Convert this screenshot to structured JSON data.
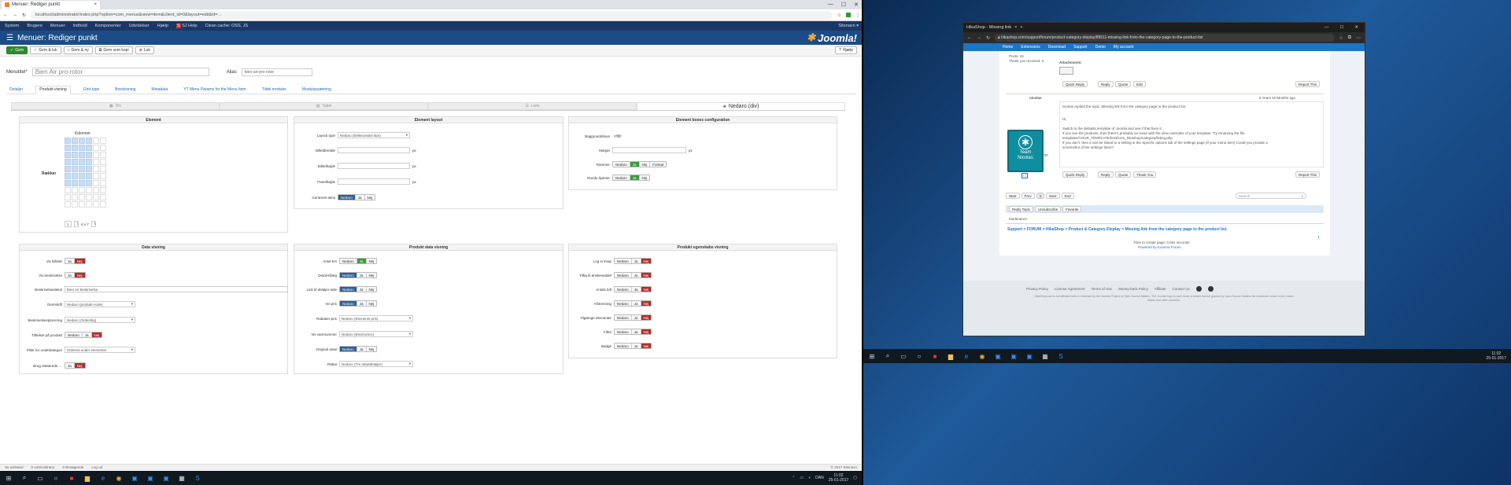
{
  "left": {
    "tab_title": "Menuer: Rediger punkt",
    "url": "localhost/administrator/index.php?option=com_menus&view=item&client_id=0&layout=edit&id=…",
    "admin_menu": [
      "System",
      "Brugere",
      "Menuer",
      "Indhold",
      "Komponenter",
      "Udvidelser",
      "Hjælp",
      "SJ Help",
      "Clean cache: OSS, JS"
    ],
    "admin_user": "Sitenavn ▾",
    "page_title": "Menuer: Rediger punkt",
    "logo_text": "Joomla!",
    "toolbar": {
      "save": "Gem",
      "save_close": "Gem & luk",
      "save_new": "Gem & ny",
      "save_copy": "Gem som kopi",
      "close": "Luk",
      "help": "Hjælp"
    },
    "menu_title_label": "Menutitel*",
    "menu_title_value": "Bien Air pro-rotor",
    "alias_label": "Alias",
    "alias_value": "bien-air-pro-rotor",
    "tabs": [
      "Detaljer",
      "Produkt-visning",
      "Grid-type",
      "Bredvisning",
      "Metadata",
      "YT Menu Params for the Menu Item",
      "Tildel moduler",
      "Modulopsætning"
    ],
    "layout_buttons": [
      "Div",
      "Tabel",
      "Liste",
      "Nedaro (div)"
    ],
    "element": {
      "title": "Element",
      "columns_label": "Kolonner",
      "rows_label": "Rækker",
      "size_value": "4 x 7"
    },
    "layout_panel": {
      "title": "Element layout",
      "rows": [
        {
          "label": "Layout type",
          "value": "Nedaro (Elektroniske Bar)"
        },
        {
          "label": "Billedbredde",
          "value": "",
          "unit": "px"
        },
        {
          "label": "Billedhøjde",
          "value": "",
          "unit": "px"
        },
        {
          "label": "Panelhøjde",
          "value": "",
          "unit": "px"
        },
        {
          "label": "Centreret tekst",
          "options": [
            "Nedaro",
            "Ja",
            "Nej"
          ]
        }
      ]
    },
    "box_panel": {
      "title": "Element boxes configuration",
      "rows": [
        {
          "label": "Baggrundsfarve",
          "value": "#ffffff"
        },
        {
          "label": "Margin",
          "value": "",
          "unit": "px"
        },
        {
          "label": "Rammer",
          "options": [
            "Nedaro",
            "Ja",
            "Nej",
            "Fortsat"
          ]
        },
        {
          "label": "Runde hjørner",
          "options": [
            "Nedaro",
            "Ja",
            "Nej"
          ]
        }
      ]
    },
    "data_panel": {
      "title": "Data visning",
      "rows": [
        {
          "label": "Vis billede",
          "options": [
            "Ja",
            "Nej"
          ]
        },
        {
          "label": "Vis beskrivelse",
          "options": [
            "Ja",
            "Nej"
          ]
        },
        {
          "label": "Beskrivelsestekst",
          "value": "Bien Air beskrivelse"
        },
        {
          "label": "Overskrift",
          "value": "Nedaro (produkt-node)"
        },
        {
          "label": "Beskrivelsesplacering",
          "value": "Nedaro (Ordentlig)"
        },
        {
          "label": "Tilbehør på produkt",
          "options": [
            "Nedaro",
            "Ja",
            "Nej"
          ]
        },
        {
          "label": "Filter for underkategori",
          "value": "Ordered under elementer"
        },
        {
          "label": "Brug relaterede …",
          "options": [
            "Ja",
            "Nej"
          ]
        }
      ]
    },
    "product_panel": {
      "title": "Produkt data visning",
      "rows": [
        {
          "label": "Antal trin",
          "options": [
            "Nedaro",
            "Ja",
            "Nej"
          ]
        },
        {
          "label": "Detail-tillæg",
          "options": [
            "Nedaro",
            "Ja",
            "Nej"
          ]
        },
        {
          "label": "Link til detaljer-side",
          "options": [
            "Nedaro",
            "Ja",
            "Nej"
          ]
        },
        {
          "label": "Vis pris",
          "options": [
            "Nedaro",
            "Ja",
            "Nej"
          ]
        },
        {
          "label": "Rabatter-pris",
          "value": "Nedaro (Elements pris)"
        },
        {
          "label": "Vis varenummer",
          "value": "Nedaro (Electronics)"
        },
        {
          "label": "Original antal",
          "options": [
            "Nedaro",
            "Ja",
            "Nej"
          ]
        },
        {
          "label": "Rabat",
          "value": "Nedaro (Tre rabatdetaljer)"
        }
      ]
    },
    "specific_panel": {
      "title": "Produkt egenskabs visning",
      "rows": [
        {
          "label": "Log in knap",
          "options": [
            "Nedaro",
            "Ja",
            "Nej"
          ]
        },
        {
          "label": "Tilføj til ønskeseddel",
          "options": [
            "Nedaro",
            "Ja",
            "Nej"
          ]
        },
        {
          "label": "Antals felt",
          "options": [
            "Nedaro",
            "Ja",
            "Nej"
          ]
        },
        {
          "label": "Afstemning",
          "options": [
            "Nedaro",
            "Ja",
            "Nej"
          ]
        },
        {
          "label": "Tilgænge elementer",
          "options": [
            "Nedaro",
            "Ja",
            "Nej"
          ]
        },
        {
          "label": "Filtre",
          "options": [
            "Nedaro",
            "Ja",
            "Nej"
          ]
        },
        {
          "label": "Badge",
          "options": [
            "Nedaro",
            "Ja",
            "Nej"
          ]
        }
      ]
    },
    "status_left": [
      "Se websted",
      "0 Administrator",
      "0 Besøgende",
      "Log ud"
    ],
    "status_right": "© 2017 Sitenavn",
    "clock_time": "11:02",
    "clock_date": "25-01-2017",
    "lang": "DAN"
  },
  "right": {
    "tab_title": "HikaShop - Missing link",
    "url": "hikashop.com/support/forum/product-category-display/89511-missing-link-from-the-category-page-to-the-product-list",
    "nav": [
      "Home",
      "Extensions",
      "Download",
      "Support",
      "Demo",
      "My account"
    ],
    "poster_top": "Posts: 16",
    "thank_top": "Thank you received: 0",
    "attachments_label": "Attachments:",
    "buttons_top": [
      "Quick Reply",
      "Reply",
      "Quote",
      "Edit",
      "Report This"
    ],
    "team_name": "nicolas",
    "avatar_lines": [
      "Team",
      "Nicolas"
    ],
    "post_date": "5 Years 10 Months ago",
    "reply_head": "nicolas replied the topic: Missing link from the category page to the product list.",
    "reply_lines": [
      "Hi,",
      "Switch to the defaults template of Joomla and see if that fixes it.",
      "If you see the products, then there's probably an issue with the view overrides of your template. Try renaming the file",
      "templates/YOUR_TEMPLATE/html/com_hikashop/category/listing.php",
      "If you don't, then it can be linked to a setting in the Specific options tab of the settings page (if your menu item) Could you provide a",
      "screenshot of the settings there?"
    ],
    "poster_meta": [
      "Posts: 69489",
      "Thank you received: 5700"
    ],
    "buttons_bottom": [
      "Quick Reply",
      "Reply",
      "Quote",
      "Thank You",
      "Report This"
    ],
    "pagination": [
      "Start",
      "Prev",
      "1",
      "Next",
      "End"
    ],
    "search_placeholder": "Search",
    "topic_buttons": [
      "Reply Topic",
      "Unsubscribe",
      "Favorite"
    ],
    "moderators": "Moderators:",
    "breadcrumb": "Support > FORUM > HikaShop > Product & Category Display > Missing link from the category page to the product list.",
    "timing": "Time to create page: 0.091 seconds",
    "powered": "Powered by Kunena Forum",
    "footer_links": [
      "Privacy Policy",
      "License Agreement",
      "Terms of Use",
      "Money-back Policy",
      "Affiliate",
      "Contact Us"
    ],
    "footer_note": "HikaShop.com is not affiliated with or endorsed by the Joomla! Project or Open Source Matters. The Joomla! logo is used under a limited license granted by Open Source Matters the trademark holder in the United States and other countries.",
    "clock_time": "11:02",
    "clock_date": "25-01-2017"
  }
}
